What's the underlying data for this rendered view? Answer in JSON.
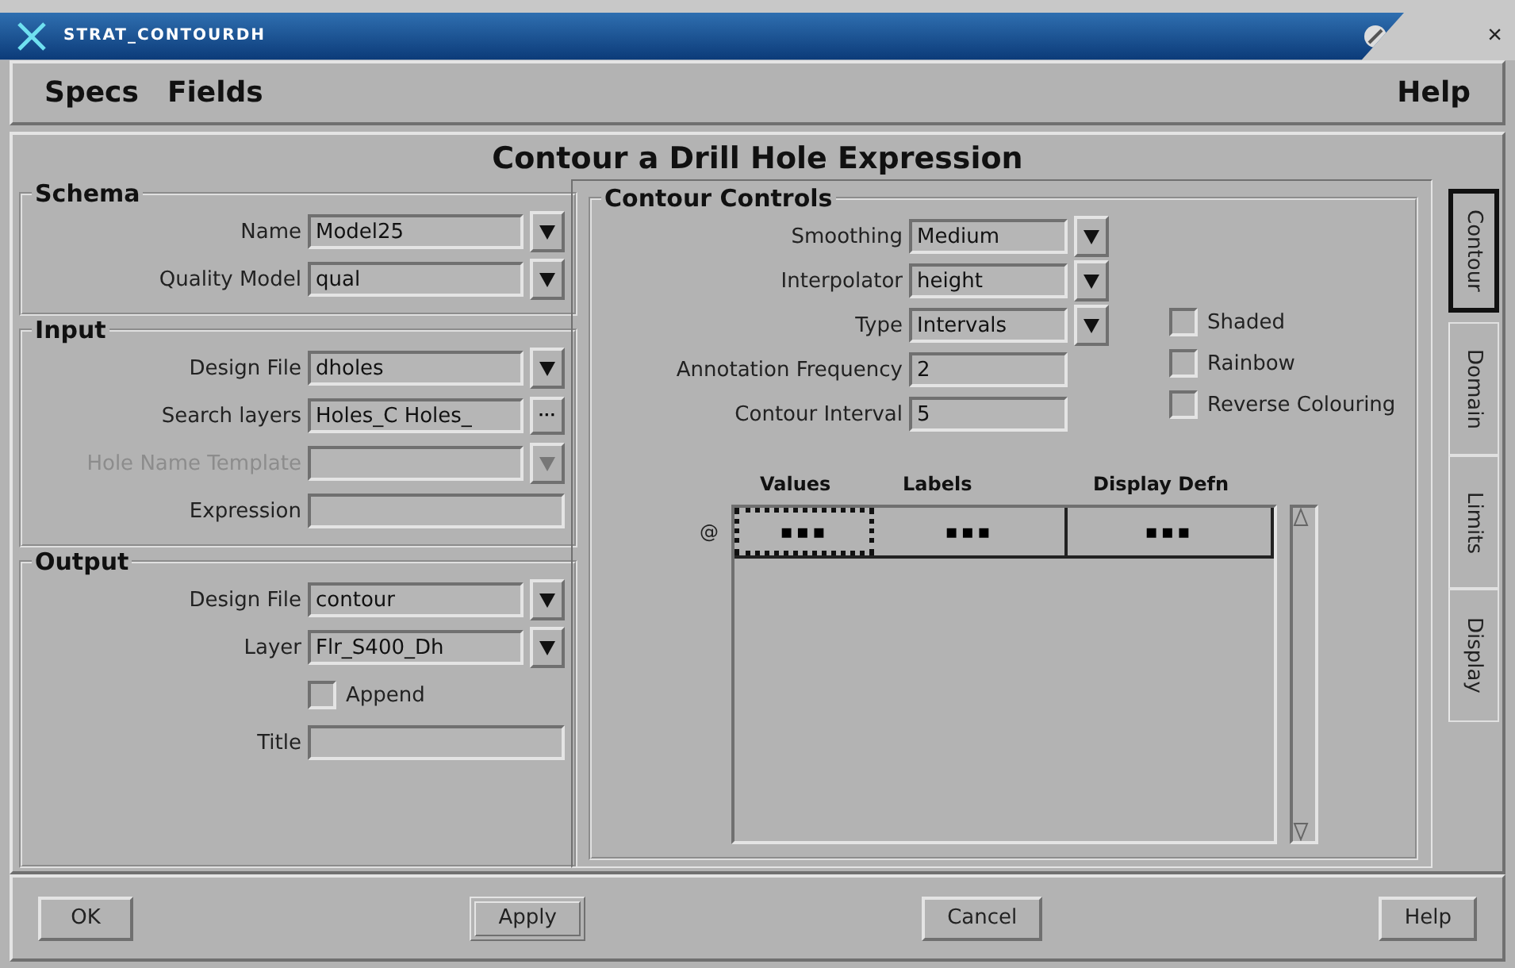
{
  "window": {
    "title": "STRAT_CONTOURDH",
    "close": "×"
  },
  "menu": {
    "left": [
      {
        "label": "Specs"
      },
      {
        "label": "Fields"
      }
    ],
    "right": [
      {
        "label": "Help"
      }
    ]
  },
  "heading": "Contour a Drill Hole Expression",
  "sections": [
    {
      "title": "Schema",
      "rows": [
        {
          "kind": "dropdown",
          "label": "Name",
          "value": "Model25",
          "disabled": false
        },
        {
          "kind": "dropdown",
          "label": "Quality Model",
          "value": "qual",
          "disabled": false
        }
      ]
    },
    {
      "title": "Input",
      "rows": [
        {
          "kind": "dropdown",
          "label": "Design File",
          "value": "dholes",
          "disabled": false
        },
        {
          "kind": "browse",
          "label": "Search layers",
          "value": "Holes_C Holes_",
          "button": "···",
          "disabled": false
        },
        {
          "kind": "dropdown",
          "label": "Hole Name Template",
          "value": "",
          "disabled": true
        },
        {
          "kind": "text",
          "label": "Expression",
          "value": "",
          "disabled": false
        }
      ]
    },
    {
      "title": "Output",
      "rows": [
        {
          "kind": "dropdown",
          "label": "Design File",
          "value": "contour",
          "disabled": false
        },
        {
          "kind": "dropdown",
          "label": "Layer",
          "value": "Flr_S400_Dh",
          "disabled": false
        },
        {
          "kind": "checkbox",
          "label": "Append",
          "checked": false
        },
        {
          "kind": "text",
          "label": "Title",
          "value": "",
          "disabled": false
        }
      ]
    }
  ],
  "contour_controls": {
    "title": "Contour Controls",
    "rows": [
      {
        "kind": "dropdown",
        "label": "Smoothing",
        "value": "Medium"
      },
      {
        "kind": "dropdown",
        "label": "Interpolator",
        "value": "height"
      },
      {
        "kind": "dropdown",
        "label": "Type",
        "value": "Intervals"
      },
      {
        "kind": "text",
        "label": "Annotation Frequency",
        "value": "2"
      },
      {
        "kind": "text",
        "label": "Contour Interval",
        "value": "5"
      }
    ],
    "options": [
      {
        "label": "Shaded",
        "checked": false
      },
      {
        "label": "Rainbow",
        "checked": false
      },
      {
        "label": "Reverse Colouring",
        "checked": false
      }
    ],
    "table": {
      "columns": [
        "Values",
        "Labels",
        "Display Defn"
      ],
      "rows": [
        {
          "marker": "@",
          "cells": [
            {
              "text": "▪▪▪",
              "focused": true
            },
            {
              "text": "▪▪▪",
              "focused": false
            },
            {
              "text": "▪▪▪",
              "focused": false
            }
          ]
        }
      ]
    }
  },
  "tabs": [
    {
      "label": "Contour",
      "selected": true
    },
    {
      "label": "Domain",
      "selected": false
    },
    {
      "label": "Limits",
      "selected": false
    },
    {
      "label": "Display",
      "selected": false
    }
  ],
  "buttons": [
    {
      "label": "OK",
      "default": false
    },
    {
      "label": "Apply",
      "default": true
    },
    {
      "label": "Cancel",
      "default": false
    },
    {
      "label": "Help",
      "default": false
    }
  ]
}
